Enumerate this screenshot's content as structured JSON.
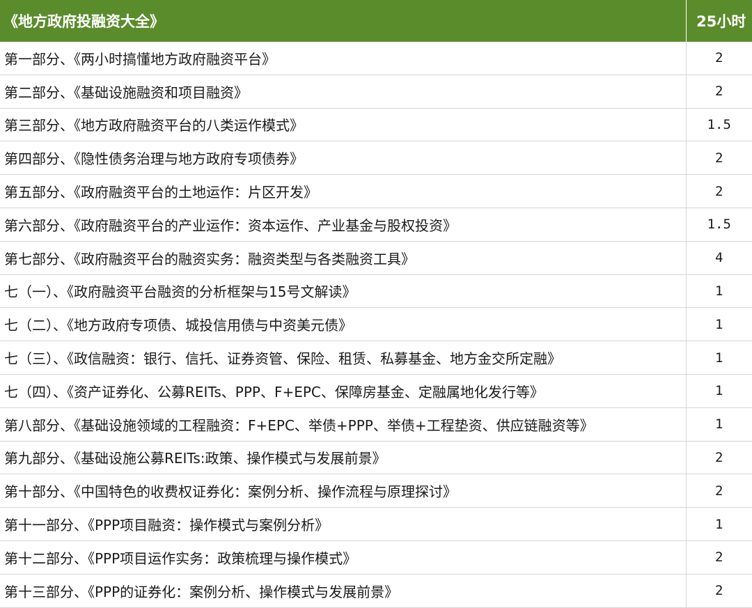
{
  "header": {
    "title": "《地方政府投融资大全》",
    "hours": "25小时"
  },
  "rows": [
    {
      "title": "第一部分、《两小时搞懂地方政府融资平台》",
      "hours": "2"
    },
    {
      "title": "第二部分、《基础设施融资和项目融资》",
      "hours": "2"
    },
    {
      "title": "第三部分、《地方政府融资平台的八类运作模式》",
      "hours": "1.5"
    },
    {
      "title": "第四部分、《隐性债务治理与地方政府专项债券》",
      "hours": "2"
    },
    {
      "title": "第五部分、《政府融资平台的土地运作：片区开发》",
      "hours": "2"
    },
    {
      "title": "第六部分、《政府融资平台的产业运作：资本运作、产业基金与股权投资》",
      "hours": "1.5"
    },
    {
      "title": "第七部分、《政府融资平台的融资实务：融资类型与各类融资工具》",
      "hours": "4"
    },
    {
      "title": "七（一）、《政府融资平台融资的分析框架与15号文解读》",
      "hours": "1"
    },
    {
      "title": "七（二）、《地方政府专项债、城投信用债与中资美元债》",
      "hours": "1"
    },
    {
      "title": "七（三）、《政信融资：银行、信托、证券资管、保险、租赁、私募基金、地方金交所定融》",
      "hours": "1"
    },
    {
      "title": "七（四）、《资产证券化、公募REITs、PPP、F+EPC、保障房基金、定融属地化发行等》",
      "hours": "1"
    },
    {
      "title": "第八部分、《基础设施领域的工程融资：F+EPC、举债+PPP、举债+工程垫资、供应链融资等》",
      "hours": "1"
    },
    {
      "title": "第九部分、《基础设施公募REITs:政策、操作模式与发展前景》",
      "hours": "2"
    },
    {
      "title": "第十部分、《中国特色的收费权证券化：案例分析、操作流程与原理探讨》",
      "hours": "2"
    },
    {
      "title": "第十一部分、《PPP项目融资：操作模式与案例分析》",
      "hours": "1"
    },
    {
      "title": "第十二部分、《PPP项目运作实务：政策梳理与操作模式》",
      "hours": "2"
    },
    {
      "title": "第十三部分、《PPP的证券化：案例分析、操作模式与发展前景》",
      "hours": "2"
    }
  ]
}
